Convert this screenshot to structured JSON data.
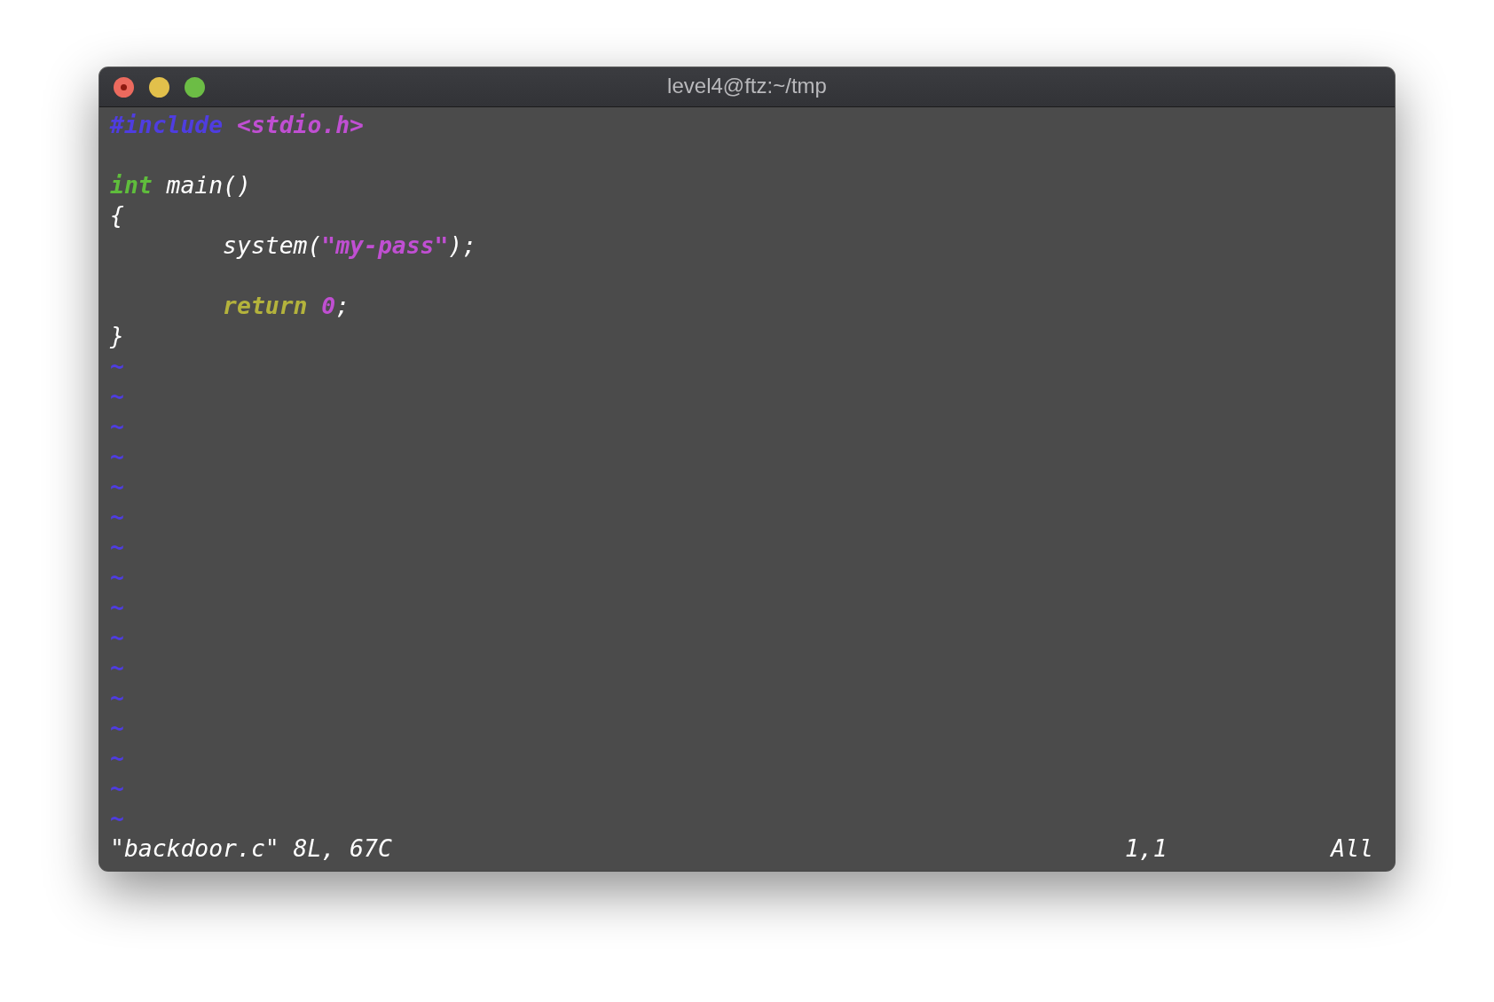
{
  "window": {
    "title": "level4@ftz:~/tmp"
  },
  "editor": {
    "lines": [
      {
        "kind": "code",
        "tokens": [
          {
            "kind": "preproc",
            "text": "#include"
          },
          {
            "kind": "string",
            "text": " <stdio.h>"
          }
        ]
      },
      {
        "kind": "blank"
      },
      {
        "kind": "code",
        "tokens": [
          {
            "kind": "type",
            "text": "int"
          },
          {
            "kind": "plain",
            "text": " main()"
          }
        ]
      },
      {
        "kind": "code",
        "tokens": [
          {
            "kind": "plain",
            "text": "{"
          }
        ]
      },
      {
        "kind": "code",
        "tokens": [
          {
            "kind": "plain",
            "text": "        system("
          },
          {
            "kind": "string",
            "text": "\"my-pass\""
          },
          {
            "kind": "plain",
            "text": ");"
          }
        ]
      },
      {
        "kind": "blank"
      },
      {
        "kind": "code",
        "tokens": [
          {
            "kind": "keyword",
            "text": "        return"
          },
          {
            "kind": "number",
            "text": " 0"
          },
          {
            "kind": "plain",
            "text": ";"
          }
        ]
      },
      {
        "kind": "code",
        "tokens": [
          {
            "kind": "plain",
            "text": "}"
          }
        ]
      }
    ],
    "tildes": [
      "~",
      "~",
      "~",
      "~",
      "~",
      "~",
      "~",
      "~",
      "~",
      "~",
      "~",
      "~",
      "~",
      "~",
      "~",
      "~"
    ]
  },
  "status_bar": {
    "message": "\"backdoor.c\" 8L, 67C",
    "ruler": "1,1",
    "position": "All"
  }
}
